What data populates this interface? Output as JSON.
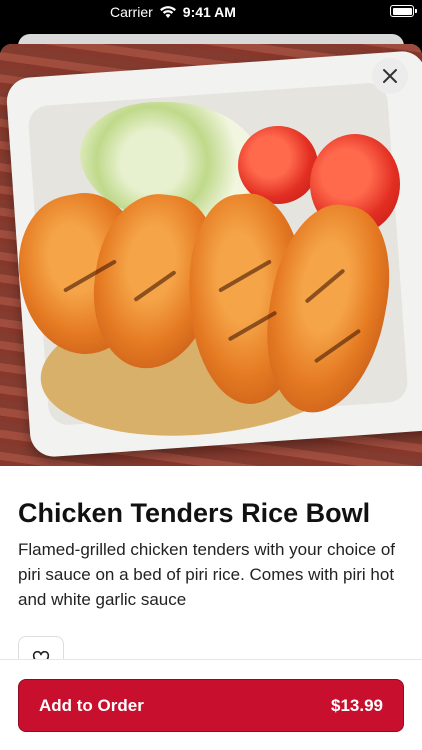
{
  "status_bar": {
    "carrier": "Carrier",
    "time": "9:41 AM",
    "icons": [
      "wifi-icon",
      "battery-icon"
    ]
  },
  "item": {
    "image_alt": "chicken-tenders-rice-bowl-photo",
    "title": "Chicken Tenders Rice Bowl",
    "description": "Flamed-grilled chicken tenders with your choice of piri sauce on a bed of piri rice. Comes with piri hot and white garlic sauce"
  },
  "actions": {
    "close_icon": "close-icon",
    "favorite_icon": "heart-icon",
    "add_to_order_label": "Add to Order",
    "price": "$13.99"
  },
  "colors": {
    "primary": "#c8102e",
    "text": "#111111"
  }
}
